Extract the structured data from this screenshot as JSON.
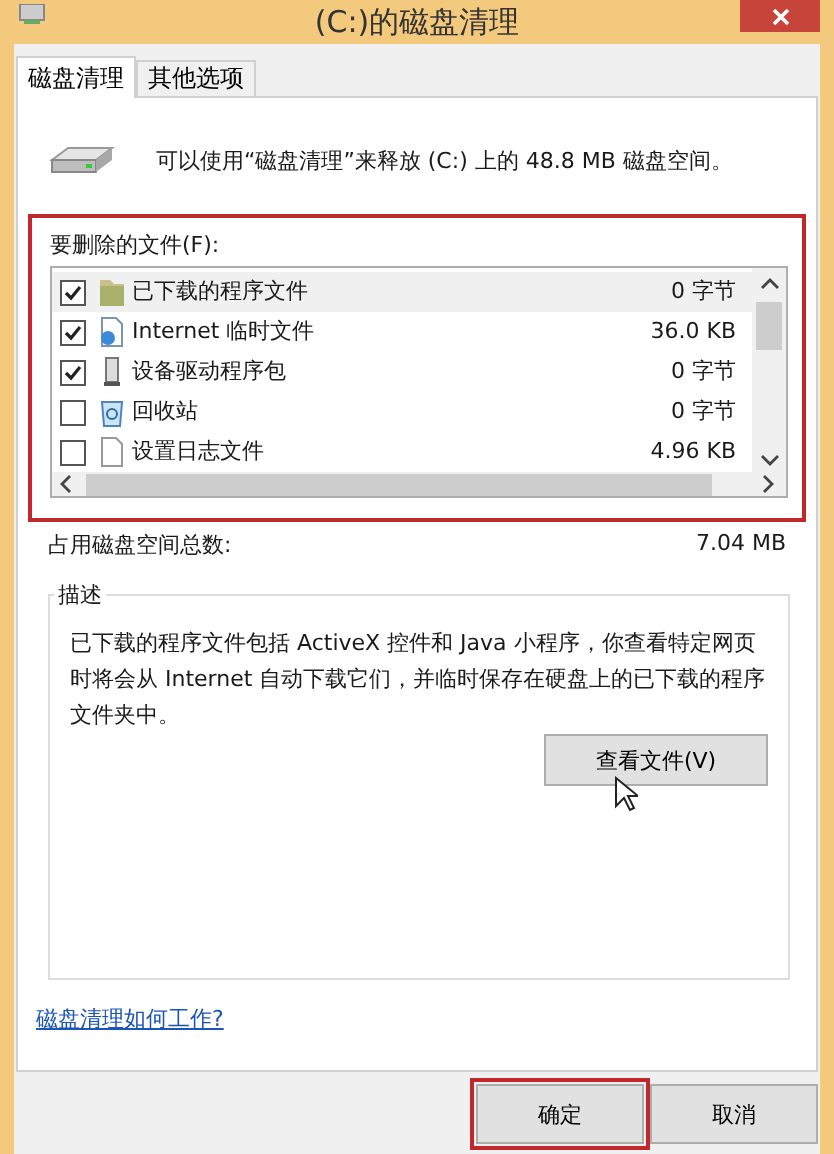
{
  "window": {
    "title": "(C:)的磁盘清理"
  },
  "tabs": [
    {
      "label": "磁盘清理",
      "selected": true
    },
    {
      "label": "其他选项",
      "selected": false
    }
  ],
  "summary": "可以使用“磁盘清理”来释放  (C:) 上的 48.8 MB 磁盘空间。",
  "files": {
    "label": "要删除的文件(F):",
    "highlighted": true,
    "items": [
      {
        "kind": "folder",
        "name": "已下载的程序文件",
        "size": "0 字节",
        "checked": true,
        "selected": true
      },
      {
        "kind": "web",
        "name": "Internet 临时文件",
        "size": "36.0 KB",
        "checked": true,
        "selected": false
      },
      {
        "kind": "driver",
        "name": "设备驱动程序包",
        "size": "0 字节",
        "checked": true,
        "selected": false
      },
      {
        "kind": "recycle",
        "name": "回收站",
        "size": "0 字节",
        "checked": false,
        "selected": false
      },
      {
        "kind": "document",
        "name": "设置日志文件",
        "size": "4.96 KB",
        "checked": false,
        "selected": false
      }
    ]
  },
  "total": {
    "label": "占用磁盘空间总数:",
    "value": "7.04 MB"
  },
  "description": {
    "title": "描述",
    "text": "已下载的程序文件包括 ActiveX 控件和 Java 小程序，你查看特定网页时将会从 Internet 自动下载它们，并临时保存在硬盘上的已下载的程序文件夹中。",
    "button": "查看文件(V)"
  },
  "help_link": "磁盘清理如何工作?",
  "buttons": [
    {
      "label": "确定",
      "highlighted": true
    },
    {
      "label": "取消",
      "highlighted": false
    }
  ]
}
